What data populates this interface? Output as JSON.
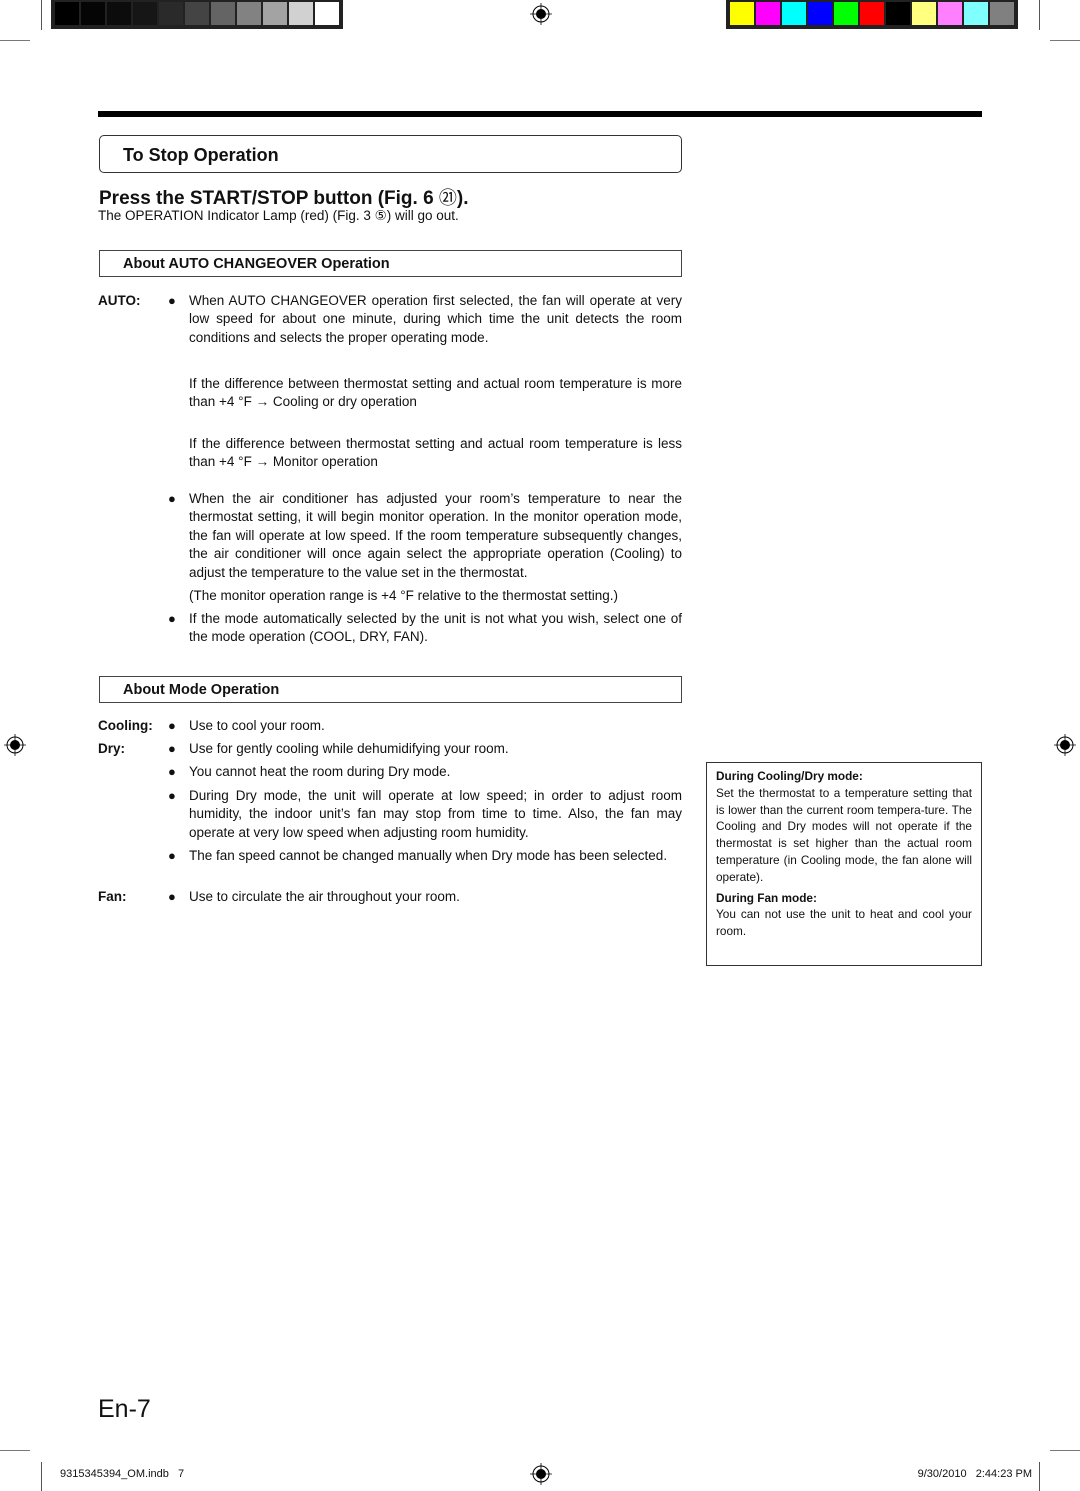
{
  "color_bars": {
    "grayscale": [
      "#000000",
      "#050505",
      "#0c0c0c",
      "#161616",
      "#2a2a2a",
      "#444444",
      "#646464",
      "#828282",
      "#a3a3a3",
      "#d1d1d1",
      "#ffffff"
    ],
    "process": [
      "#ffff00",
      "#ff00ff",
      "#00ffff",
      "#0000ff",
      "#00ff00",
      "#ff0000",
      "#000000",
      "#ffff80",
      "#ff80ff",
      "#80ffff",
      "#808080"
    ]
  },
  "section": {
    "title": "To Stop Operation",
    "heading": "Press the START/STOP button (Fig. 6 ㏭).",
    "heading_pre": "Press the START/STOP button (Fig. 6 ",
    "heading_ref": "㉑",
    "heading_post": ").",
    "intro_pre": "The OPERATION Indicator Lamp (red) (Fig. 3 ",
    "intro_ref": "⑤",
    "intro_post": ") will go out."
  },
  "auto": {
    "box_title": "About AUTO CHANGEOVER Operation",
    "label": "AUTO:",
    "bullet": "●",
    "p1": "When AUTO CHANGEOVER operation first selected, the fan will operate at very low speed for about one minute, during which time the unit detects the room conditions and selects the proper operating mode.",
    "p2": "If the difference between thermostat setting and actual room temperature is more than +4 °F → Cooling or dry operation",
    "p3": "If the difference between thermostat setting and actual room temperature is less than +4 °F → Monitor operation",
    "p4": "When the air conditioner has adjusted your room’s temperature to near the thermostat setting, it will begin monitor operation. In the monitor operation mode, the fan will operate at low speed. If the room temperature subsequently changes, the air conditioner will once again select the appropriate operation (Cooling) to adjust the temperature to the value set in the thermostat.",
    "p5": "(The monitor operation range is +4 °F relative to the thermostat setting.)",
    "p6": "If the mode automatically selected by the unit is not what you wish, select one of the mode operation (COOL, DRY, FAN)."
  },
  "mode": {
    "box_title": "About Mode Operation",
    "cooling_label": "Cooling:",
    "cooling_1": "Use to cool your room.",
    "dry_label": "Dry:",
    "dry_1": "Use for gently cooling while dehumidifying your room.",
    "dry_2": "You cannot heat the room during Dry mode.",
    "dry_3": "During Dry mode, the unit will operate at low speed; in order to adjust room humidity, the indoor unit’s fan may stop from time to time. Also, the fan may operate at very low speed when adjusting room humidity.",
    "dry_4": "The fan speed cannot be changed manually when Dry mode has been selected.",
    "fan_label": "Fan:",
    "fan_1": "Use to circulate the air throughout your room."
  },
  "note": {
    "h1": "During Cooling/Dry mode:",
    "b1": "Set the thermostat to a temperature setting that is lower than the current room tempera-ture. The Cooling and Dry modes will not operate if the thermostat is set higher than the actual room temperature (in Cooling mode, the fan alone will operate).",
    "h2": "During Fan mode:",
    "b2": "You can not use the unit to heat and cool your room."
  },
  "page_number": "En-7",
  "footer": {
    "file": "9315345394_OM.indb   7",
    "timestamp": "9/30/2010   2:44:23 PM"
  }
}
